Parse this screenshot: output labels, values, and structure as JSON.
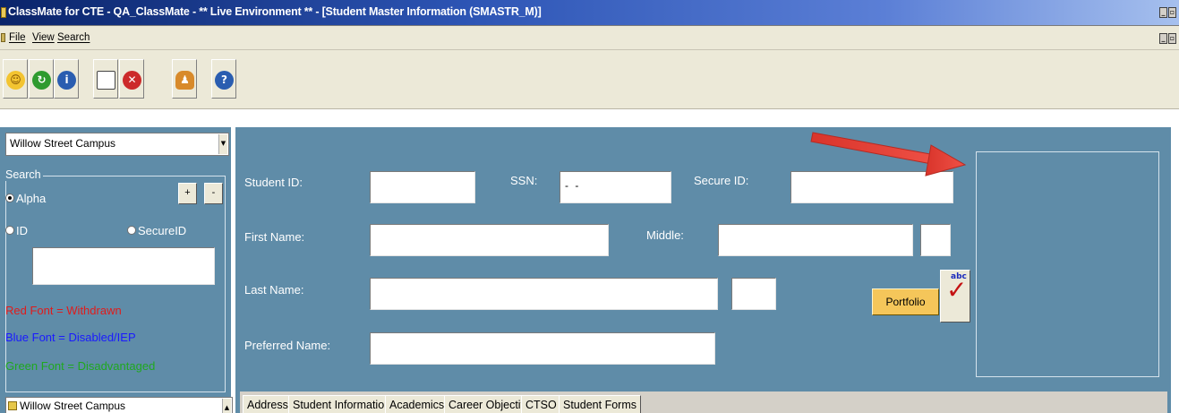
{
  "window": {
    "title": "ClassMate for CTE - QA_ClassMate - ** Live Environment ** - [Student Master Information (SMASTR_M)]"
  },
  "menu": {
    "items": [
      "File",
      "View",
      "Search"
    ]
  },
  "toolbar": {
    "buttons": [
      {
        "icon": "smiley-face-icon",
        "color": "#f3c431"
      },
      {
        "icon": "green-refresh-icon",
        "color": "#2f9b2f"
      },
      {
        "icon": "blue-info-icon",
        "color": "#2a5db0"
      },
      {
        "icon": "new-document-icon",
        "color": "#ffffff"
      },
      {
        "icon": "red-delete-icon",
        "color": "#cc2a2a"
      },
      {
        "icon": "user-icon",
        "color": "#d88a2b"
      },
      {
        "icon": "help-icon",
        "color": "#2a5db0"
      }
    ]
  },
  "left": {
    "campus_select": "Willow Street Campus",
    "search_label": "Search",
    "radio_alpha": "Alpha",
    "radio_id": "ID",
    "radio_secure": "SecureID",
    "plus": "+",
    "minus": "-",
    "search_value": "",
    "legend_red": "Red Font = Withdrawn",
    "legend_blue": "Blue Font = Disabled/IEP",
    "legend_green": "Green Font = Disadvantaged",
    "legend_colors": {
      "red": "#e01b1b",
      "blue": "#1a1aff",
      "green": "#1fa81f"
    },
    "tree_item": "Willow Street Campus"
  },
  "form": {
    "student_id_label": "Student ID:",
    "student_id_value": "",
    "ssn_label": "SSN:",
    "ssn_value": "- -",
    "secure_id_label": "Secure ID:",
    "secure_id_value": "",
    "first_name_label": "First Name:",
    "first_name_value": "",
    "middle_label": "Middle:",
    "middle_value": "",
    "suffix_value": "",
    "last_name_label": "Last Name:",
    "last_name_value": "",
    "last_extra_value": "",
    "preferred_name_label": "Preferred Name:",
    "preferred_name_value": "",
    "portfolio_button": "Portfolio",
    "spell_check_icon_text": "abc"
  },
  "tabs": [
    "Address",
    "Student Information",
    "Academics",
    "Career Objective",
    "CTSO",
    "Student Forms"
  ],
  "colors": {
    "panel_bg": "#5f8ca8",
    "arrow": "#e53d33"
  }
}
